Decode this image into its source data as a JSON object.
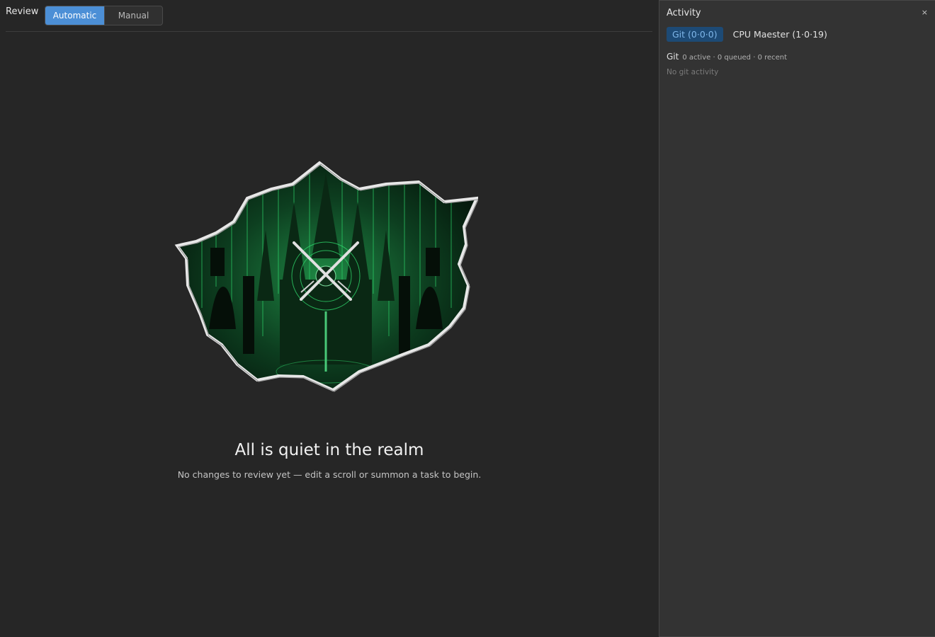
{
  "review": {
    "title": "Review",
    "modes": {
      "automatic": "Automatic",
      "manual": "Manual",
      "active": "automatic"
    },
    "empty_title": "All is quiet in the realm",
    "empty_subtitle": "No changes to review yet — edit a scroll or summon a task to begin."
  },
  "activity": {
    "title": "Activity",
    "close_glyph": "×",
    "tabs": [
      {
        "label": "Git (0·0·0)",
        "active": true
      },
      {
        "label": "CPU Maester (1·0·19)",
        "active": false
      }
    ],
    "git_label": "Git",
    "git_stats": "0 active · 0 queued · 0 recent",
    "git_empty": "No git activity"
  },
  "colors": {
    "accent": "#4c8fd6",
    "active_tab_bg": "#1d4a75",
    "matrix_green": "#2fd46a"
  },
  "icons": {
    "illustration": "torn-paper-matrix-castle-crossed-swords",
    "close": "close-icon"
  }
}
